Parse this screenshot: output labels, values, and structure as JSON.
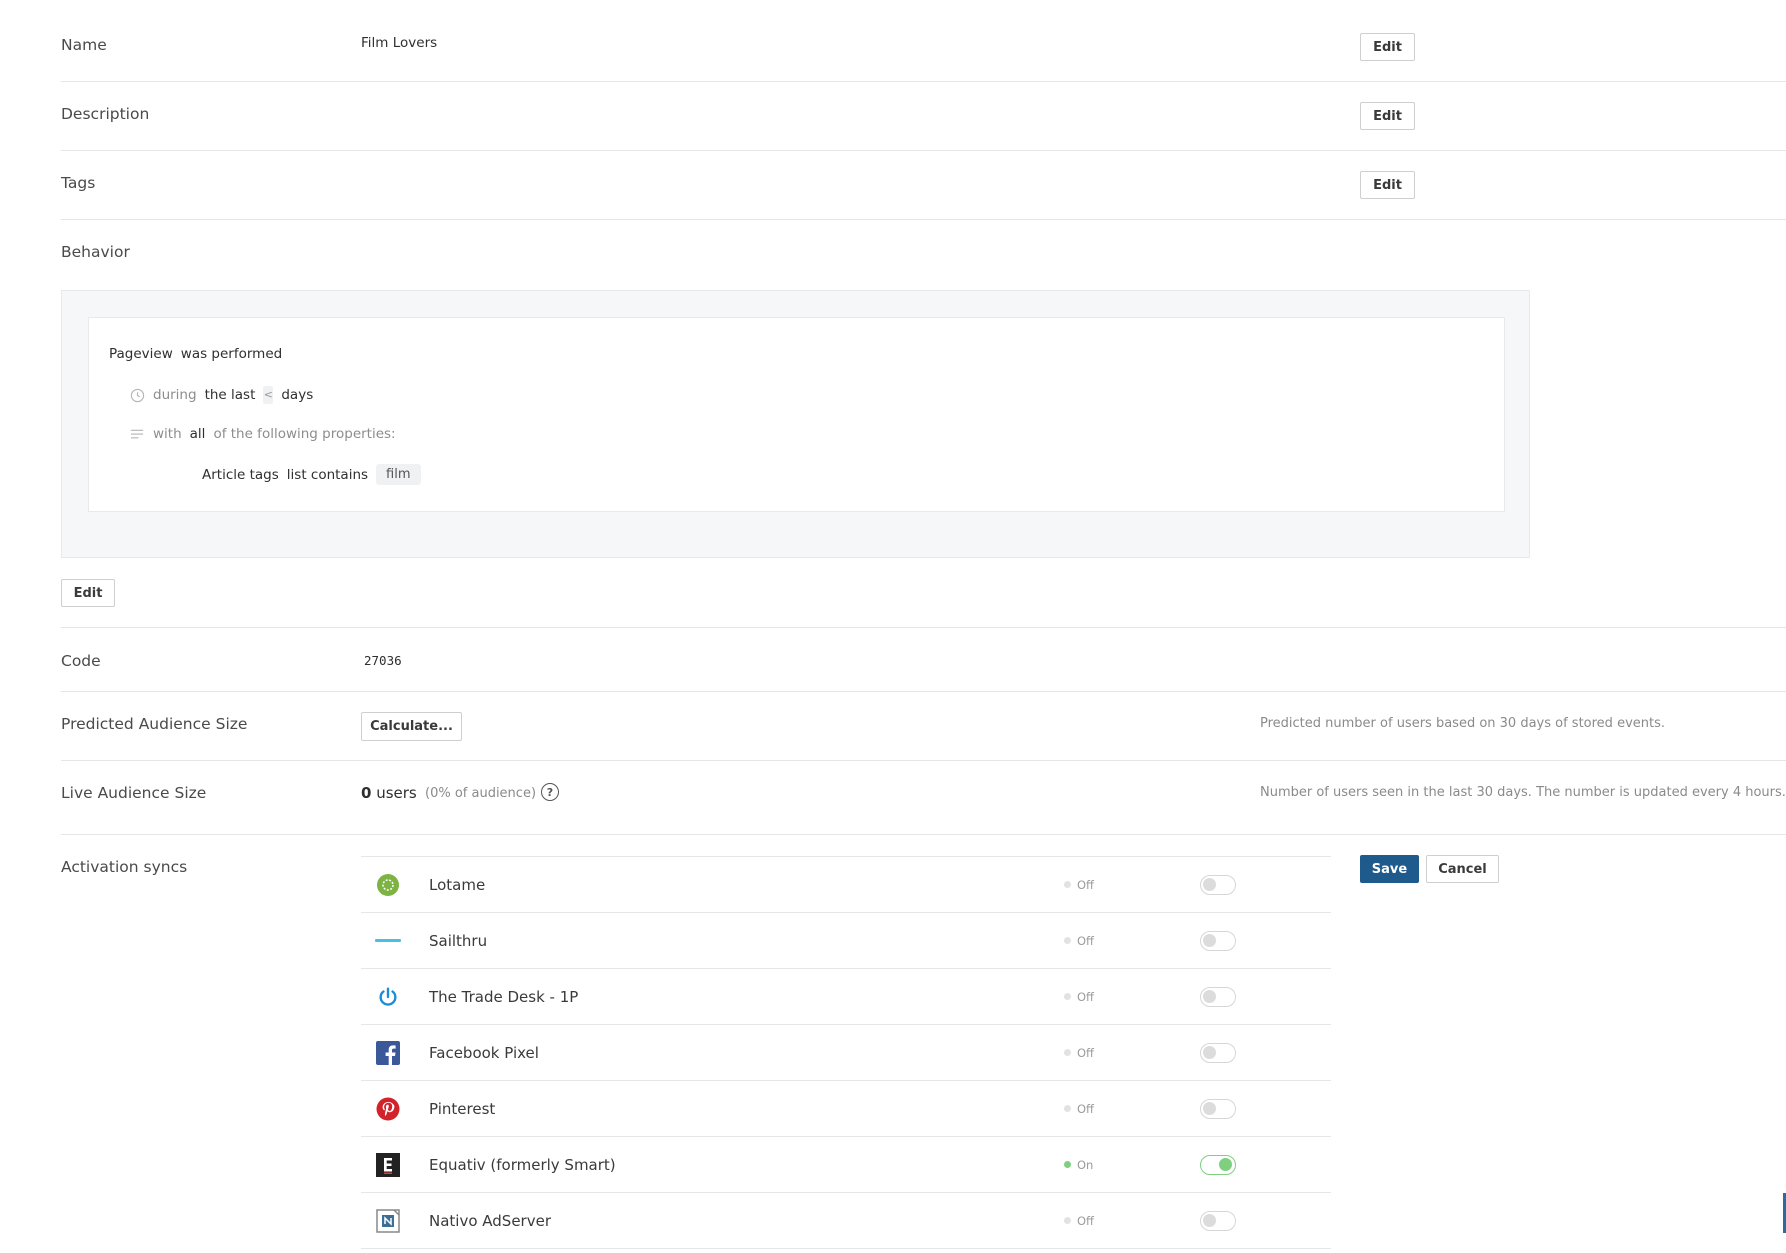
{
  "fields": {
    "name": {
      "label": "Name",
      "value": "Film Lovers",
      "edit": "Edit"
    },
    "description": {
      "label": "Description",
      "edit": "Edit"
    },
    "tags": {
      "label": "Tags",
      "edit": "Edit"
    },
    "behavior": {
      "label": "Behavior",
      "edit": "Edit"
    },
    "code": {
      "label": "Code",
      "value": "27036"
    },
    "predicted": {
      "label": "Predicted Audience Size",
      "button": "Calculate...",
      "hint": "Predicted number of users based on 30 days of stored events."
    },
    "live": {
      "label": "Live Audience Size",
      "count": "0",
      "unit": "users",
      "percent": "(0% of audience)",
      "help": "?",
      "hint": "Number of users seen in the last 30 days. The number is updated every 4 hours."
    },
    "activation": {
      "label": "Activation syncs",
      "save": "Save",
      "cancel": "Cancel"
    }
  },
  "behavior_rule": {
    "event": "Pageview",
    "verb": "was performed",
    "during": "during",
    "range": "the last",
    "days_value": "<",
    "days": "days",
    "with": "with",
    "quantifier": "all",
    "tail": "of the following properties:",
    "property": "Article tags",
    "operator": "list contains",
    "value": "film"
  },
  "syncs": [
    {
      "name": "Lotame",
      "status": "Off",
      "on": false,
      "icon": "lotame-logo-icon",
      "color": "#7cb342"
    },
    {
      "name": "Sailthru",
      "status": "Off",
      "on": false,
      "icon": "sailthru-logo-icon",
      "color": "#29b6d8"
    },
    {
      "name": "The Trade Desk - 1P",
      "status": "Off",
      "on": false,
      "icon": "trade-desk-logo-icon",
      "color": "#1a8cd8"
    },
    {
      "name": "Facebook Pixel",
      "status": "Off",
      "on": false,
      "icon": "facebook-logo-icon",
      "color": "#3b5998"
    },
    {
      "name": "Pinterest",
      "status": "Off",
      "on": false,
      "icon": "pinterest-logo-icon",
      "color": "#d2232a"
    },
    {
      "name": "Equativ (formerly Smart)",
      "status": "On",
      "on": true,
      "icon": "equativ-logo-icon",
      "color": "#222222"
    },
    {
      "name": "Nativo AdServer",
      "status": "Off",
      "on": false,
      "icon": "nativo-logo-icon",
      "color": "#3d6e96"
    }
  ],
  "colors": {
    "primary": "#1f5a8c",
    "on": "#7ed07e",
    "divider": "#e6e6e6"
  }
}
